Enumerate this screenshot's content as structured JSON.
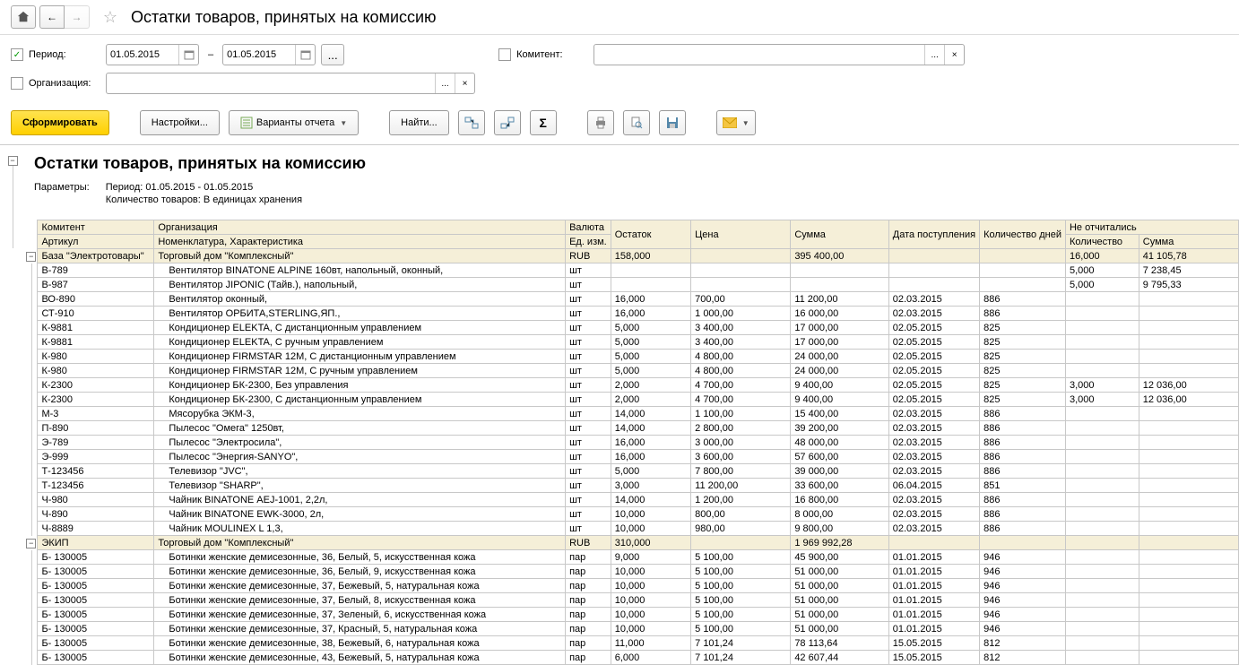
{
  "header": {
    "title": "Остатки товаров, принятых на комиссию"
  },
  "filters": {
    "period_checked": true,
    "period_label": "Период:",
    "date_from": "01.05.2015",
    "date_to": "01.05.2015",
    "komitent_label": "Комитент:",
    "komitent_value": "",
    "org_label": "Организация:",
    "org_value": ""
  },
  "toolbar": {
    "generate": "Сформировать",
    "settings": "Настройки...",
    "variants": "Варианты отчета",
    "find": "Найти..."
  },
  "report": {
    "title": "Остатки товаров, принятых на комиссию",
    "params_label": "Параметры:",
    "period_line": "Период: 01.05.2015 - 01.05.2015",
    "qty_line": "Количество товаров: В единицах хранения",
    "columns": {
      "komitent": "Комитент",
      "org": "Организация",
      "valuta": "Валюта",
      "ostatok": "Остаток",
      "price": "Цена",
      "sum": "Сумма",
      "date": "Дата поступления",
      "days": "Количество дней",
      "not_reported": "Не отчитались",
      "artikul": "Артикул",
      "nomenklatura": "Номенклатура, Характеристика",
      "ed": "Ед. изм.",
      "nqty": "Количество",
      "nsum": "Сумма"
    },
    "groups": [
      {
        "komitent": "База \"Электротовары\"",
        "org": "Торговый дом \"Комплексный\"",
        "valuta": "RUB",
        "ostatok": "158,000",
        "sum": "395 400,00",
        "nqty": "16,000",
        "nsum": "41 105,78",
        "rows": [
          {
            "art": "В-789",
            "nom": "Вентилятор BINATONE ALPINE 160вт, напольный, оконный,",
            "ed": "шт",
            "ost": "",
            "price": "",
            "sum": "",
            "date": "",
            "days": "",
            "nqty": "5,000",
            "nsum": "7 238,45"
          },
          {
            "art": "В-987",
            "nom": "Вентилятор JIPONIC (Тайв.), напольный,",
            "ed": "шт",
            "ost": "",
            "price": "",
            "sum": "",
            "date": "",
            "days": "",
            "nqty": "5,000",
            "nsum": "9 795,33"
          },
          {
            "art": "ВО-890",
            "nom": "Вентилятор оконный,",
            "ed": "шт",
            "ost": "16,000",
            "price": "700,00",
            "sum": "11 200,00",
            "date": "02.03.2015",
            "days": "886",
            "nqty": "",
            "nsum": ""
          },
          {
            "art": "СТ-910",
            "nom": "Вентилятор ОРБИТА,STERLING,ЯП.,",
            "ed": "шт",
            "ost": "16,000",
            "price": "1 000,00",
            "sum": "16 000,00",
            "date": "02.03.2015",
            "days": "886",
            "nqty": "",
            "nsum": ""
          },
          {
            "art": "К-9881",
            "nom": "Кондиционер ELEKTA, С дистанционным управлением",
            "ed": "шт",
            "ost": "5,000",
            "price": "3 400,00",
            "sum": "17 000,00",
            "date": "02.05.2015",
            "days": "825",
            "nqty": "",
            "nsum": ""
          },
          {
            "art": "К-9881",
            "nom": "Кондиционер ELEKTA, С ручным управлением",
            "ed": "шт",
            "ost": "5,000",
            "price": "3 400,00",
            "sum": "17 000,00",
            "date": "02.05.2015",
            "days": "825",
            "nqty": "",
            "nsum": ""
          },
          {
            "art": "К-980",
            "nom": "Кондиционер FIRMSTAR 12M, С дистанционным управлением",
            "ed": "шт",
            "ost": "5,000",
            "price": "4 800,00",
            "sum": "24 000,00",
            "date": "02.05.2015",
            "days": "825",
            "nqty": "",
            "nsum": ""
          },
          {
            "art": "К-980",
            "nom": "Кондиционер FIRMSTAR 12M, С ручным управлением",
            "ed": "шт",
            "ost": "5,000",
            "price": "4 800,00",
            "sum": "24 000,00",
            "date": "02.05.2015",
            "days": "825",
            "nqty": "",
            "nsum": ""
          },
          {
            "art": "К-2300",
            "nom": "Кондиционер БК-2300, Без управления",
            "ed": "шт",
            "ost": "2,000",
            "price": "4 700,00",
            "sum": "9 400,00",
            "date": "02.05.2015",
            "days": "825",
            "nqty": "3,000",
            "nsum": "12 036,00"
          },
          {
            "art": "К-2300",
            "nom": "Кондиционер БК-2300, С дистанционным управлением",
            "ed": "шт",
            "ost": "2,000",
            "price": "4 700,00",
            "sum": "9 400,00",
            "date": "02.05.2015",
            "days": "825",
            "nqty": "3,000",
            "nsum": "12 036,00"
          },
          {
            "art": "М-3",
            "nom": "Мясорубка ЭКМ-3,",
            "ed": "шт",
            "ost": "14,000",
            "price": "1 100,00",
            "sum": "15 400,00",
            "date": "02.03.2015",
            "days": "886",
            "nqty": "",
            "nsum": ""
          },
          {
            "art": "П-890",
            "nom": "Пылесос \"Омега\" 1250вт,",
            "ed": "шт",
            "ost": "14,000",
            "price": "2 800,00",
            "sum": "39 200,00",
            "date": "02.03.2015",
            "days": "886",
            "nqty": "",
            "nsum": ""
          },
          {
            "art": "Э-789",
            "nom": "Пылесос \"Электросила\",",
            "ed": "шт",
            "ost": "16,000",
            "price": "3 000,00",
            "sum": "48 000,00",
            "date": "02.03.2015",
            "days": "886",
            "nqty": "",
            "nsum": ""
          },
          {
            "art": "Э-999",
            "nom": "Пылесос \"Энергия-SANYO\",",
            "ed": "шт",
            "ost": "16,000",
            "price": "3 600,00",
            "sum": "57 600,00",
            "date": "02.03.2015",
            "days": "886",
            "nqty": "",
            "nsum": ""
          },
          {
            "art": "Т-123456",
            "nom": "Телевизор \"JVC\",",
            "ed": "шт",
            "ost": "5,000",
            "price": "7 800,00",
            "sum": "39 000,00",
            "date": "02.03.2015",
            "days": "886",
            "nqty": "",
            "nsum": ""
          },
          {
            "art": "Т-123456",
            "nom": "Телевизор \"SHARP\",",
            "ed": "шт",
            "ost": "3,000",
            "price": "11 200,00",
            "sum": "33 600,00",
            "date": "06.04.2015",
            "days": "851",
            "nqty": "",
            "nsum": ""
          },
          {
            "art": "Ч-980",
            "nom": "Чайник BINATONE  АЕJ-1001,  2,2л,",
            "ed": "шт",
            "ost": "14,000",
            "price": "1 200,00",
            "sum": "16 800,00",
            "date": "02.03.2015",
            "days": "886",
            "nqty": "",
            "nsum": ""
          },
          {
            "art": "Ч-890",
            "nom": "Чайник BINATONE  EWK-3000,  2л,",
            "ed": "шт",
            "ost": "10,000",
            "price": "800,00",
            "sum": "8 000,00",
            "date": "02.03.2015",
            "days": "886",
            "nqty": "",
            "nsum": ""
          },
          {
            "art": "Ч-8889",
            "nom": "Чайник MOULINEX L 1,3,",
            "ed": "шт",
            "ost": "10,000",
            "price": "980,00",
            "sum": "9 800,00",
            "date": "02.03.2015",
            "days": "886",
            "nqty": "",
            "nsum": ""
          }
        ]
      },
      {
        "komitent": "ЭКИП",
        "org": "Торговый дом \"Комплексный\"",
        "valuta": "RUB",
        "ostatok": "310,000",
        "sum": "1 969 992,28",
        "nqty": "",
        "nsum": "",
        "rows": [
          {
            "art": "Б- 130005",
            "nom": "Ботинки женские демисезонные, 36, Белый, 5, искусственная кожа",
            "ed": "пар",
            "ost": "9,000",
            "price": "5 100,00",
            "sum": "45 900,00",
            "date": "01.01.2015",
            "days": "946",
            "nqty": "",
            "nsum": ""
          },
          {
            "art": "Б- 130005",
            "nom": "Ботинки женские демисезонные, 36, Белый, 9, искусственная кожа",
            "ed": "пар",
            "ost": "10,000",
            "price": "5 100,00",
            "sum": "51 000,00",
            "date": "01.01.2015",
            "days": "946",
            "nqty": "",
            "nsum": ""
          },
          {
            "art": "Б- 130005",
            "nom": "Ботинки женские демисезонные, 37, Бежевый, 5, натуральная кожа",
            "ed": "пар",
            "ost": "10,000",
            "price": "5 100,00",
            "sum": "51 000,00",
            "date": "01.01.2015",
            "days": "946",
            "nqty": "",
            "nsum": ""
          },
          {
            "art": "Б- 130005",
            "nom": "Ботинки женские демисезонные, 37, Белый, 8, искусственная кожа",
            "ed": "пар",
            "ost": "10,000",
            "price": "5 100,00",
            "sum": "51 000,00",
            "date": "01.01.2015",
            "days": "946",
            "nqty": "",
            "nsum": ""
          },
          {
            "art": "Б- 130005",
            "nom": "Ботинки женские демисезонные, 37, Зеленый, 6, искусственная кожа",
            "ed": "пар",
            "ost": "10,000",
            "price": "5 100,00",
            "sum": "51 000,00",
            "date": "01.01.2015",
            "days": "946",
            "nqty": "",
            "nsum": ""
          },
          {
            "art": "Б- 130005",
            "nom": "Ботинки женские демисезонные, 37, Красный, 5, натуральная кожа",
            "ed": "пар",
            "ost": "10,000",
            "price": "5 100,00",
            "sum": "51 000,00",
            "date": "01.01.2015",
            "days": "946",
            "nqty": "",
            "nsum": ""
          },
          {
            "art": "Б- 130005",
            "nom": "Ботинки женские демисезонные, 38, Бежевый, 6, натуральная кожа",
            "ed": "пар",
            "ost": "11,000",
            "price": "7 101,24",
            "sum": "78 113,64",
            "date": "15.05.2015",
            "days": "812",
            "nqty": "",
            "nsum": ""
          },
          {
            "art": "Б- 130005",
            "nom": "Ботинки женские демисезонные, 43, Бежевый, 5, натуральная кожа",
            "ed": "пар",
            "ost": "6,000",
            "price": "7 101,24",
            "sum": "42 607,44",
            "date": "15.05.2015",
            "days": "812",
            "nqty": "",
            "nsum": ""
          }
        ]
      }
    ]
  }
}
